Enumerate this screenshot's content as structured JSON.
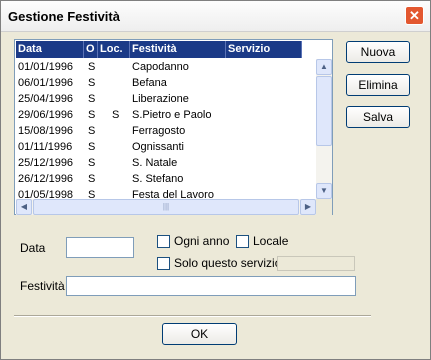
{
  "window": {
    "title": "Gestione Festività",
    "close_icon": "close-icon"
  },
  "list": {
    "columns": [
      "Data",
      "O",
      "Loc.",
      "Festività",
      "Servizio"
    ],
    "rows": [
      {
        "data": "01/01/1996",
        "o": "S",
        "loc": "",
        "festivita": "Capodanno",
        "servizio": ""
      },
      {
        "data": "06/01/1996",
        "o": "S",
        "loc": "",
        "festivita": "Befana",
        "servizio": ""
      },
      {
        "data": "25/04/1996",
        "o": "S",
        "loc": "",
        "festivita": "Liberazione",
        "servizio": ""
      },
      {
        "data": "29/06/1996",
        "o": "S",
        "loc": "S",
        "festivita": "S.Pietro e Paolo",
        "servizio": ""
      },
      {
        "data": "15/08/1996",
        "o": "S",
        "loc": "",
        "festivita": "Ferragosto",
        "servizio": ""
      },
      {
        "data": "01/11/1996",
        "o": "S",
        "loc": "",
        "festivita": "Ognissanti",
        "servizio": ""
      },
      {
        "data": "25/12/1996",
        "o": "S",
        "loc": "",
        "festivita": "S. Natale",
        "servizio": ""
      },
      {
        "data": "26/12/1996",
        "o": "S",
        "loc": "",
        "festivita": "S. Stefano",
        "servizio": ""
      },
      {
        "data": "01/05/1998",
        "o": "S",
        "loc": "",
        "festivita": "Festa del Lavoro",
        "servizio": ""
      }
    ]
  },
  "buttons": {
    "nuova": "Nuova",
    "elimina": "Elimina",
    "salva": "Salva",
    "ok": "OK"
  },
  "form": {
    "data_label": "Data",
    "data_value": "",
    "ogni_anno": "Ogni anno",
    "locale": "Locale",
    "solo_questo_servizio": "Solo questo servizio",
    "festivita_label": "Festività",
    "festivita_value": ""
  },
  "colors": {
    "header_bg": "#1b3a87",
    "window_bg": "#ece9d8",
    "close_bg": "#e3572f"
  }
}
